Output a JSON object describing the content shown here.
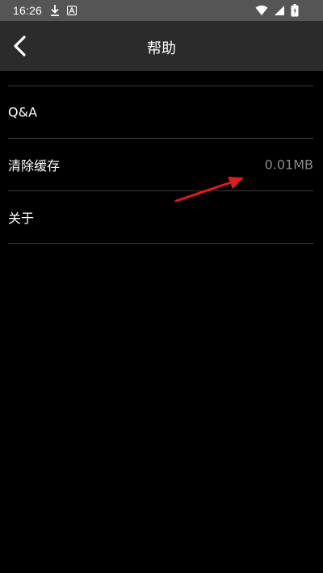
{
  "status_bar": {
    "time": "16:26",
    "icons": [
      "download-icon",
      "app-a-icon",
      "wifi-icon",
      "signal-icon",
      "battery-icon"
    ]
  },
  "header": {
    "back_icon": "chevron-left-icon",
    "title": "帮助"
  },
  "list": {
    "items": [
      {
        "label": "Q&A",
        "value": ""
      },
      {
        "label": "清除缓存",
        "value": "0.01MB"
      },
      {
        "label": "关于",
        "value": ""
      }
    ]
  },
  "annotation": {
    "color": "#e0191b"
  },
  "colors": {
    "status_bar_bg": "#555555",
    "header_bg": "#2b2b2b",
    "page_bg": "#000000",
    "divider": "#3a3a3a",
    "value_text": "#8a8a8a"
  }
}
